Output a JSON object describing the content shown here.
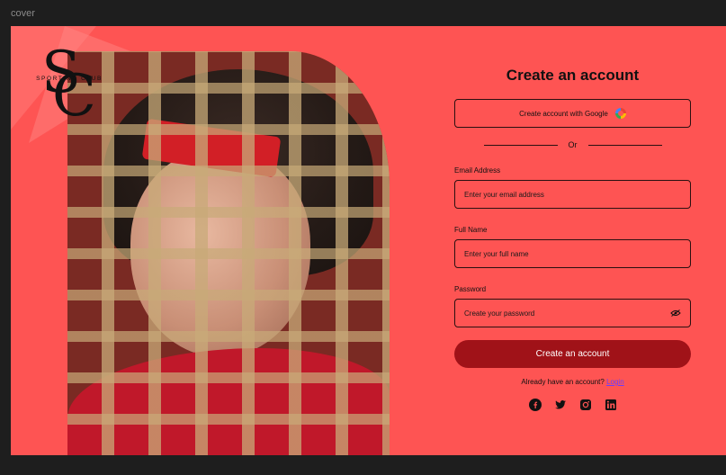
{
  "frame_label": "cover",
  "brand": {
    "monogram_top": "S",
    "monogram_bottom": "C",
    "tagline": "SPORTING CLUB"
  },
  "form": {
    "title": "Create an account",
    "google_button": "Create account with Google",
    "divider_text": "Or",
    "email": {
      "label": "Email Address",
      "placeholder": "Enter your email address"
    },
    "fullname": {
      "label": "Full Name",
      "placeholder": "Enter your full name"
    },
    "password": {
      "label": "Password",
      "placeholder": "Create your password"
    },
    "submit": "Create an account",
    "signin_prompt": "Already have an account?",
    "signin_link": "Login",
    "socials": [
      "facebook-icon",
      "twitter-icon",
      "instagram-icon",
      "linkedin-icon"
    ]
  },
  "colors": {
    "background": "#fe5453",
    "primary_button": "#a01218",
    "link": "#6a3cff"
  }
}
